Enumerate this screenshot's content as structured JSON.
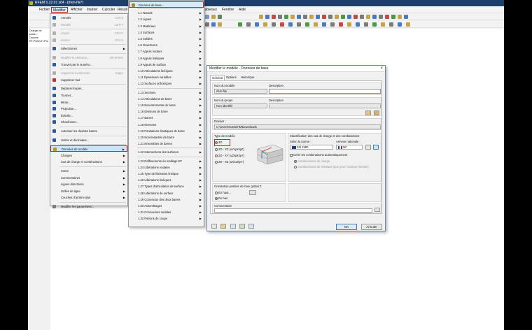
{
  "window": {
    "title": "RFEM 5.22.01 x64 - [rfem-file*]"
  },
  "menubar": {
    "items": [
      "Fichier",
      "Modifier",
      "Afficher",
      "Insérer",
      "Calculer",
      "Résult",
      "Tableaux",
      "Fenêtre",
      "Aide"
    ]
  },
  "navigator": {
    "lines": [
      "Charge de poids...",
      "Coupes",
      "RF-PUNCH Pro"
    ]
  },
  "modifier_menu": {
    "rows": [
      {
        "label": "Annuler",
        "shortcut": "Ctrl+Z",
        "disabled": false
      },
      {
        "label": "Rétablir",
        "shortcut": "Ctrl+Y",
        "disabled": true
      },
      {
        "label": "Copier",
        "shortcut": "Ctrl+C",
        "disabled": true
      },
      {
        "label": "Insérer",
        "shortcut": "Ctrl+V",
        "disabled": true
      },
      {
        "label": "Sélectionner",
        "submenu": true
      },
      {
        "label": "Modifier la sélection...",
        "shortcut": "Alt+Entrée",
        "disabled": true
      },
      {
        "label": "Trouver par le numéro..."
      },
      {
        "label": "Supprimer la sélection",
        "shortcut": "Suppr",
        "disabled": true
      },
      {
        "label": "Supprimer tout"
      },
      {
        "label": "Déplacer/copier..."
      },
      {
        "label": "Tourner..."
      },
      {
        "label": "Miroir..."
      },
      {
        "label": "Projection..."
      },
      {
        "label": "Échelle..."
      },
      {
        "label": "Chanfreiner..."
      },
      {
        "label": "Autoriser les doubles barres"
      },
      {
        "label": "Unités et décimales..."
      },
      {
        "label": "Données de modèle",
        "submenu": true,
        "highlight": true
      },
      {
        "label": "Charges",
        "submenu": true
      },
      {
        "label": "Cas de charge et combinaisons",
        "submenu": true
      },
      {
        "label": "Cotes",
        "submenu": true
      },
      {
        "label": "Commentaires",
        "submenu": true
      },
      {
        "label": "Lignes directrices",
        "submenu": true
      },
      {
        "label": "Grilles de ligne",
        "submenu": true
      },
      {
        "label": "Couches d'arrière-plan",
        "submenu": true
      },
      {
        "label": "Modifier les paramètres..."
      }
    ]
  },
  "model_data_menu": {
    "rows": [
      "Données de base...",
      "1.1 Nœuds",
      "1.2 Lignes",
      "1.3 Matériaux",
      "1.4 Surfaces",
      "1.5 Solides",
      "1.6 Ouvertures",
      "1.7 Appuis nodaux",
      "1.8 Appuis linéiques",
      "1.9 Appuis de surface",
      "1.10 Articulations linéiques",
      "1.11 Épaisseurs variables",
      "1.12 Surfaces orthotropes",
      "1.13 Sections",
      "1.14 Articulations de barre",
      "1.15 Excentrements de barre",
      "1.16 Divisions de barre",
      "1.17 Barres",
      "1.18 Nervures",
      "1.19 Fondations élastiques de barre",
      "1.20 Non-linéarités de barre",
      "1.21 Ensembles de barres",
      "1.22 Intersections des surfaces",
      "1.23 Raffinements du maillage EF",
      "1.24 Libérations nodales",
      "1.25 Type de libération linéique",
      "1.26 Libérations linéiques",
      "1.27 Types d'articulation de surface",
      "1.28 Libérations de surface",
      "1.29 Connexion des deux barres",
      "1.30 Assemblages",
      "1.31 Connexions nodales",
      "1.32 Patrons de coupe"
    ]
  },
  "dialog": {
    "title": "Modifier le modèle - Données de base",
    "close": "×",
    "tabs": [
      "Général",
      "Options",
      "Historique"
    ],
    "model_name_label": "Nom du modèle",
    "model_name_value": "rfem-file",
    "description_label": "Description",
    "project_name_label": "Nom du projet",
    "project_name_value": "Non identifié",
    "project_description_label": "Description",
    "folder_label": "Dossier :",
    "folder_value": "C:\\Users\\HusseinM\\Downloads",
    "model_type_label": "Type de modèle",
    "model_types": [
      "3D",
      "2D - XZ (uY/φX/φZ)",
      "2D - XY (uZ/φX/φY)",
      "2D - XZ (uX/uZ/φY)"
    ],
    "classification_label": "Classification des cas de charge et des combinaisons",
    "norm_label": "Selon la norme :",
    "norm_value": "EN 1990",
    "annex_label": "Annexe nationale :",
    "annex_value": "NF",
    "auto_combos_label": "Créer les combinaisons automatiquement",
    "combo_load_label": "Combinaisons de charge",
    "combo_result_label": "Combinaisons de résultats (que pour l'analyse linéaire)",
    "gz_label": "Orientation positive de l'axe global Z",
    "gz_up": "En haut...",
    "gz_down": "En bas",
    "comment_label": "Commentaire",
    "ok": "OK",
    "cancel": "Annuler"
  },
  "colors": {
    "titlebar": "#1f3f6b",
    "highlight_border": "#cc2020",
    "menu_hover": "#cde4f7"
  }
}
